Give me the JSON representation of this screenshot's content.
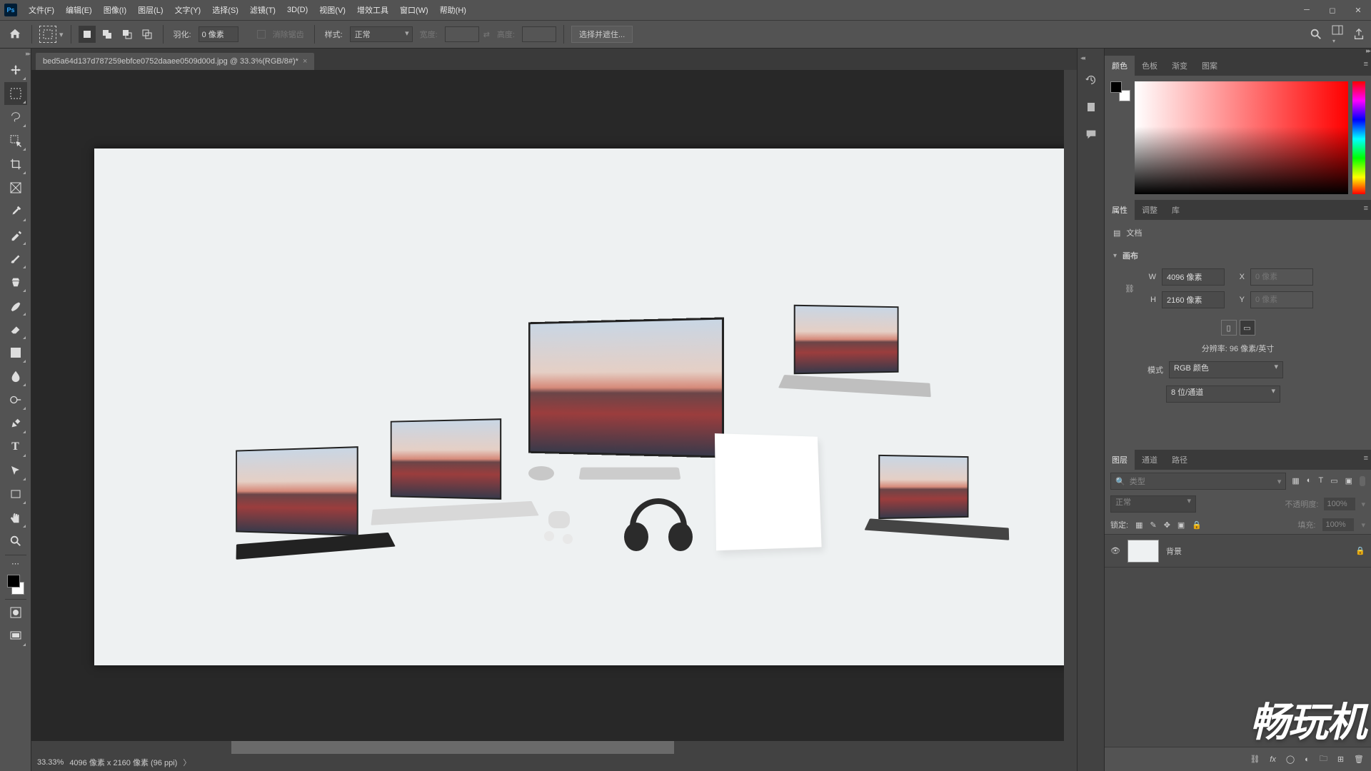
{
  "app": "Photoshop",
  "menus": [
    "文件(F)",
    "编辑(E)",
    "图像(I)",
    "图层(L)",
    "文字(Y)",
    "选择(S)",
    "滤镜(T)",
    "3D(D)",
    "视图(V)",
    "增效工具",
    "窗口(W)",
    "帮助(H)"
  ],
  "options": {
    "feather_label": "羽化:",
    "feather_value": "0 像素",
    "antialias": "消除锯齿",
    "style_label": "样式:",
    "style_value": "正常",
    "width_label": "宽度:",
    "height_label": "高度:",
    "mask_button": "选择并遮住..."
  },
  "document": {
    "tab_title": "bed5a64d137d787259ebfce0752daaee0509d00d.jpg @ 33.3%(RGB/8#)*",
    "status_zoom": "33.33%",
    "status_dims": "4096 像素 x 2160 像素 (96 ppi)"
  },
  "panel_tabs": {
    "color": [
      "颜色",
      "色板",
      "渐变",
      "图案"
    ],
    "props": [
      "属性",
      "调整",
      "库"
    ],
    "layers": [
      "图层",
      "通道",
      "路径"
    ]
  },
  "properties": {
    "doc_label": "文档",
    "canvas_label": "画布",
    "W": "W",
    "H": "H",
    "X": "X",
    "Y": "Y",
    "w_value": "4096 像素",
    "h_value": "2160 像素",
    "xy_placeholder": "0 像素",
    "resolution": "分辨率: 96 像素/英寸",
    "mode_label": "模式",
    "mode_value": "RGB 颜色",
    "depth_value": "8 位/通道"
  },
  "layers": {
    "filter_placeholder": "类型",
    "blend_mode": "正常",
    "opacity_label": "不透明度:",
    "opacity_value": "100%",
    "lock_label": "锁定:",
    "fill_label": "填充:",
    "fill_value": "100%",
    "bg_layer": "背景"
  },
  "watermark": "畅玩机"
}
